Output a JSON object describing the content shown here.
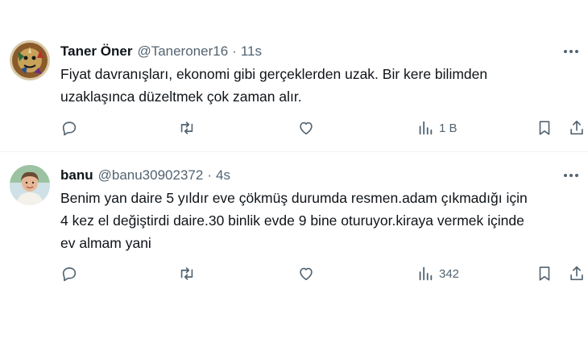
{
  "tweets": [
    {
      "author": {
        "name": "Taner Öner",
        "handle": "@Taneroner16"
      },
      "separator": "·",
      "time": "11s",
      "text_lines": [
        "Fiyat davranışları, ekonomi gibi gerçeklerden uzak. Bir kere bilimden",
        "uzaklaşınca düzeltmek çok zaman alır."
      ],
      "views": "1 B"
    },
    {
      "author": {
        "name": "banu",
        "handle": "@banu30902372"
      },
      "separator": "·",
      "time": "4s",
      "text_lines": [
        "Benim yan daire 5 yıldır eve çökmüş durumda resmen.adam çıkmadığı için",
        "4 kez el değiştirdi daire.30 binlik evde 9 bine oturuyor.kiraya vermek içinde",
        "ev almam yani"
      ],
      "views": "342"
    }
  ],
  "icons": {
    "reply": "reply-icon",
    "retweet": "retweet-icon",
    "like": "heart-icon",
    "views": "views-icon",
    "bookmark": "bookmark-icon",
    "share": "share-icon",
    "more": "more-icon"
  },
  "colors": {
    "text": "#0f1419",
    "secondary": "#536471",
    "divider": "#eff3f4"
  }
}
